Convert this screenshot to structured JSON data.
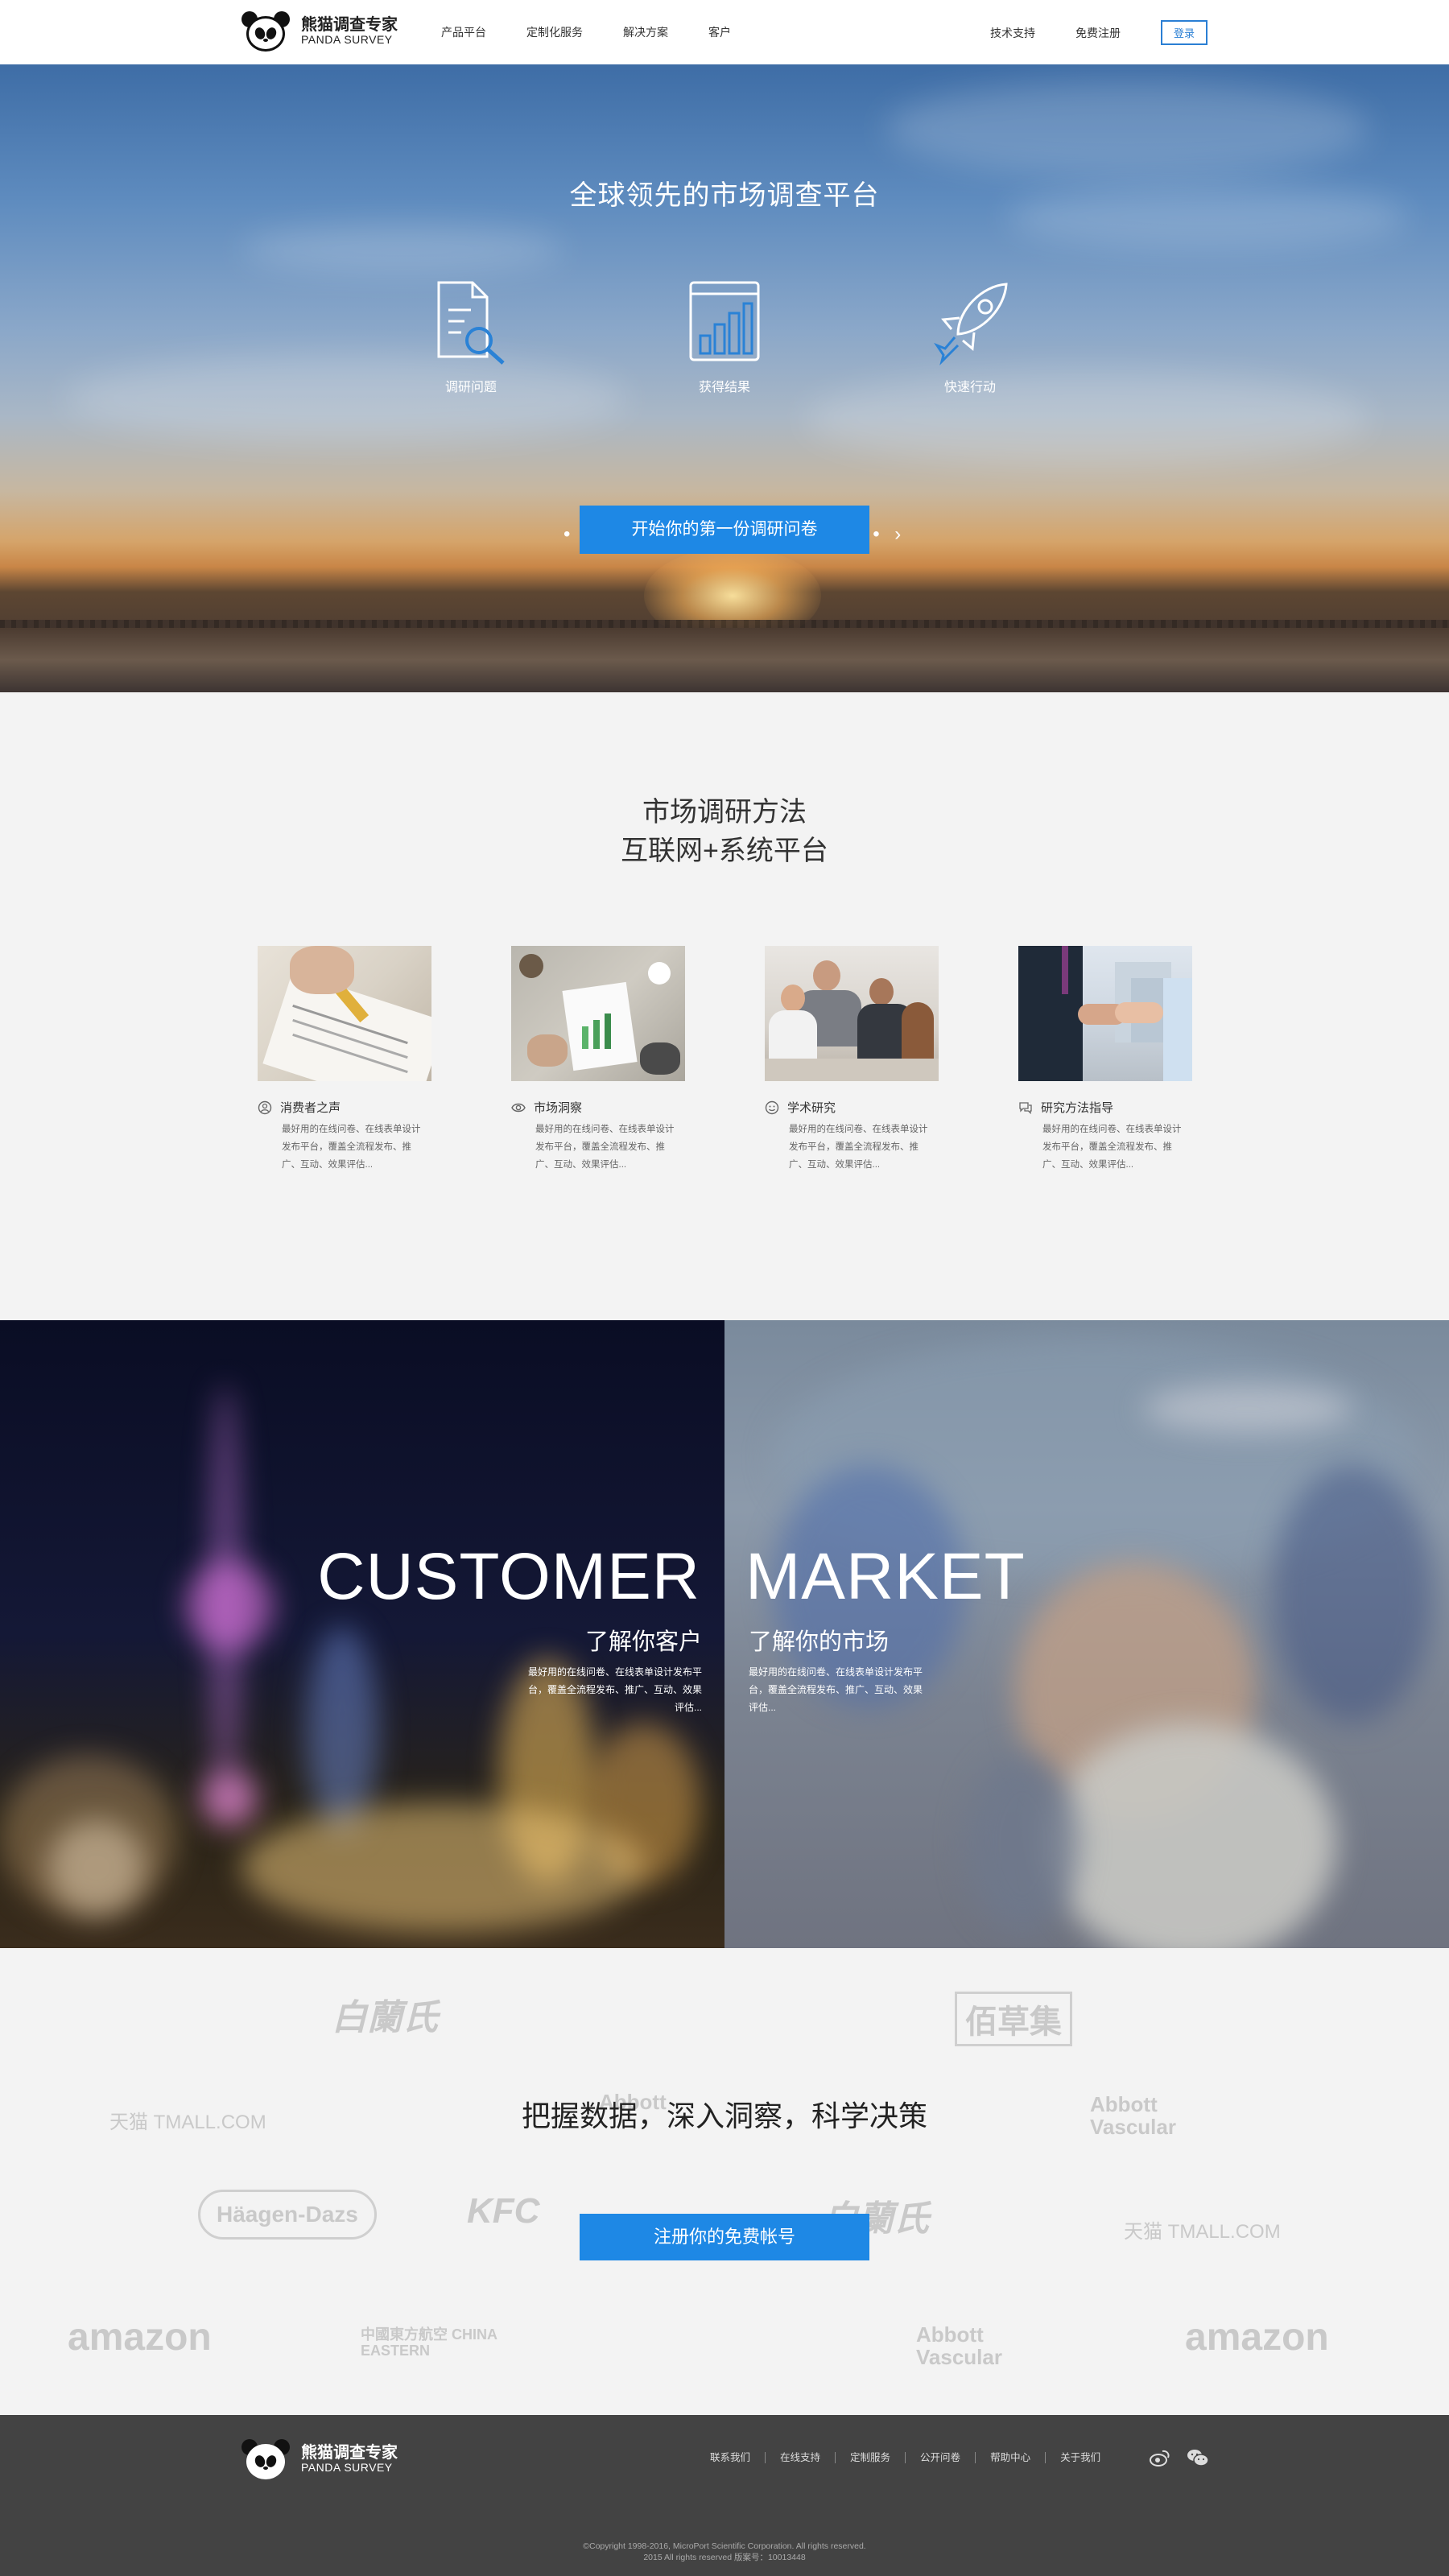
{
  "header": {
    "logo_cn": "熊猫调查专家",
    "logo_en": "PANDA SURVEY",
    "nav": [
      "产品平台",
      "定制化服务",
      "解决方案",
      "客户"
    ],
    "support": "技术支持",
    "register": "免费注册",
    "login": "登录"
  },
  "hero": {
    "title": "全球领先的市场调查平台",
    "steps": [
      {
        "label": "调研问题",
        "icon": "document-search-icon"
      },
      {
        "label": "获得结果",
        "icon": "bar-chart-book-icon"
      },
      {
        "label": "快速行动",
        "icon": "rocket-icon"
      }
    ],
    "cta": "开始你的第一份调研问卷"
  },
  "methods": {
    "title1": "市场调研方法",
    "title2": "互联网+系统平台",
    "cards": [
      {
        "title": "消费者之声",
        "icon": "user-icon",
        "desc": "最好用的在线问卷、在线表单设计发布平台，覆盖全流程发布、推广、互动、效果评估..."
      },
      {
        "title": "市场洞察",
        "icon": "eye-icon",
        "desc": "最好用的在线问卷、在线表单设计发布平台，覆盖全流程发布、推广、互动、效果评估..."
      },
      {
        "title": "学术研究",
        "icon": "smile-icon",
        "desc": "最好用的在线问卷、在线表单设计发布平台，覆盖全流程发布、推广、互动、效果评估..."
      },
      {
        "title": "研究方法指导",
        "icon": "chat-icon",
        "desc": "最好用的在线问卷、在线表单设计发布平台，覆盖全流程发布、推广、互动、效果评估..."
      }
    ]
  },
  "split": {
    "left_big": "CUSTOMER",
    "left_sub": "了解你客户",
    "left_desc": "最好用的在线问卷、在线表单设计发布平台，覆盖全流程发布、推广、互动、效果评估...",
    "right_big": "MARKET",
    "right_sub": "了解你的市场",
    "right_desc": "最好用的在线问卷、在线表单设计发布平台，覆盖全流程发布、推广、互动、效果评估..."
  },
  "brands": {
    "title": "把握数据，深入洞察，科学决策",
    "cta": "注册你的免费帐号",
    "logos": [
      "白蘭氏",
      "佰草集",
      "天猫 TMALL.COM",
      "Abbott Vascular",
      "Häagen-Dazs",
      "KFC",
      "白蘭氏",
      "天猫 TMALL.COM",
      "amazon",
      "中國東方航空 CHINA EASTERN",
      "Abbott Vascular",
      "amazon",
      "Abbott"
    ]
  },
  "footer": {
    "logo_cn": "熊猫调查专家",
    "logo_en": "PANDA SURVEY",
    "links": [
      "联系我们",
      "在线支持",
      "定制服务",
      "公开问卷",
      "帮助中心",
      "关于我们"
    ],
    "copyright1": "©Copyright 1998-2016, MicroPort Scientific Corporation. All rights reserved.",
    "copyright2": "2015 All rights reserved 版案号：10013448"
  }
}
